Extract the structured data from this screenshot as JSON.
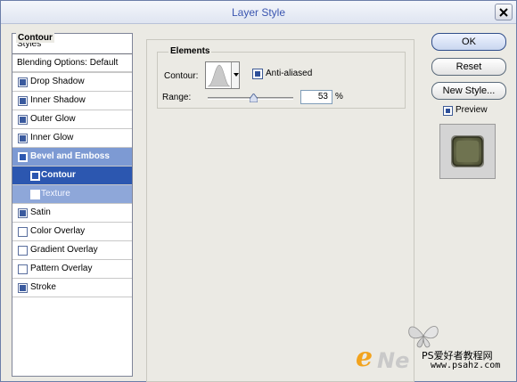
{
  "window": {
    "title": "Layer Style"
  },
  "styles_panel": {
    "header": "Styles",
    "blending": "Blending Options: Default",
    "items": [
      {
        "label": "Drop Shadow",
        "checked": true
      },
      {
        "label": "Inner Shadow",
        "checked": true
      },
      {
        "label": "Outer Glow",
        "checked": true
      },
      {
        "label": "Inner Glow",
        "checked": true
      },
      {
        "label": "Bevel and Emboss",
        "checked": true
      },
      {
        "label": "Contour",
        "checked": true
      },
      {
        "label": "Texture",
        "checked": false
      },
      {
        "label": "Satin",
        "checked": true
      },
      {
        "label": "Color Overlay",
        "checked": false
      },
      {
        "label": "Gradient Overlay",
        "checked": false
      },
      {
        "label": "Pattern Overlay",
        "checked": false
      },
      {
        "label": "Stroke",
        "checked": true
      }
    ]
  },
  "contour_panel": {
    "group_title": "Contour",
    "elements_title": "Elements",
    "contour_label": "Contour:",
    "anti_aliased_label": "Anti-aliased",
    "anti_aliased_checked": true,
    "range_label": "Range:",
    "range_value": "53",
    "range_unit": "%"
  },
  "buttons": {
    "ok": "OK",
    "reset": "Reset",
    "new_style": "New Style...",
    "preview_label": "Preview",
    "preview_checked": true
  },
  "watermark": {
    "e": "e",
    "ne": "Ne",
    "chinese": "PS爱好者教程网",
    "url": "www.psahz.com"
  },
  "colors": {
    "title_text": "#3b56b0",
    "selection": "#2c57b0",
    "parent_highlight": "#7d9ad3"
  }
}
